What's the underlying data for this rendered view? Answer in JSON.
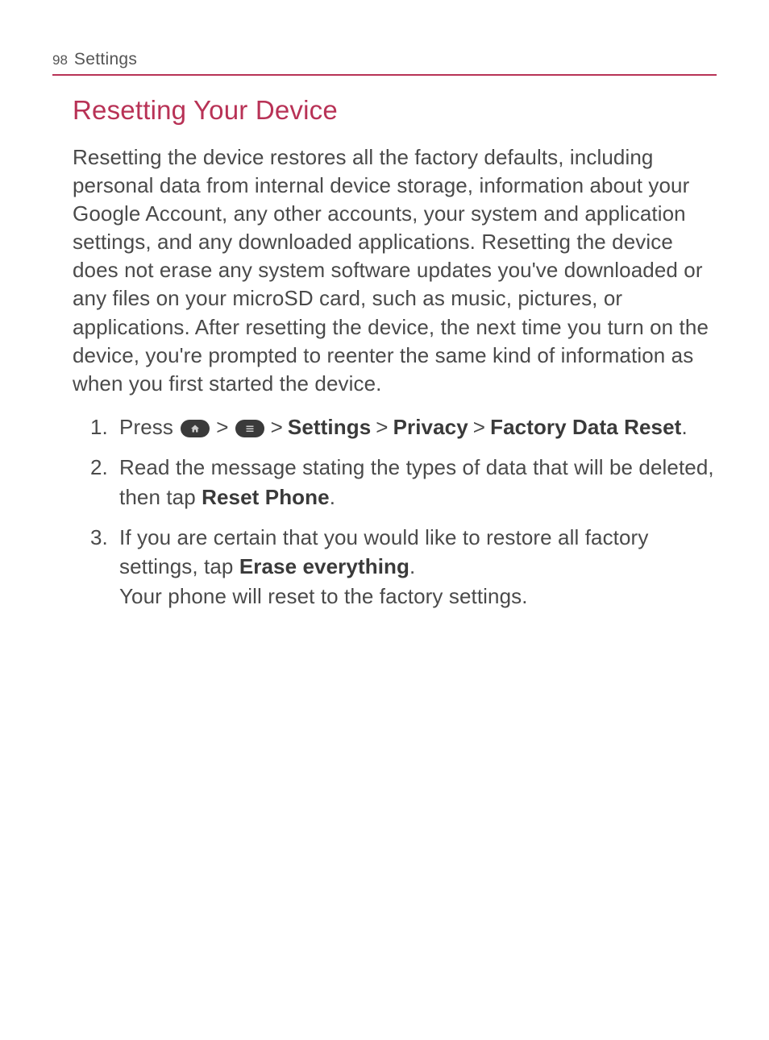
{
  "header": {
    "page_number": "98",
    "section": "Settings"
  },
  "content": {
    "heading": "Resetting Your Device",
    "intro": "Resetting the device restores all the factory defaults, including personal data from internal device storage, information about your Google Account, any other accounts, your system and application settings, and any downloaded applications. Resetting the device does not erase any system software updates you've downloaded or any files on your microSD card, such as music, pictures, or applications. After resetting the device, the next time you turn on the device, you're prompted to reenter the same kind of information as when you first started the device.",
    "steps": [
      {
        "number": "1.",
        "prefix": "Press ",
        "icon1_name": "home-button-icon",
        "sep1": ">",
        "icon2_name": "menu-button-icon",
        "sep2": ">",
        "bold1": "Settings",
        "sep3": ">",
        "bold2": "Privacy",
        "sep4": ">",
        "bold3": "Factory Data Reset",
        "suffix": "."
      },
      {
        "number": "2.",
        "text_before": "Read the message stating the types of data that will be deleted, then tap ",
        "bold": "Reset Phone",
        "text_after": "."
      },
      {
        "number": "3.",
        "text_before": "If you are certain that you would like to restore all factory settings, tap ",
        "bold": "Erase everything",
        "text_after": ".",
        "line2": "Your phone will reset to the factory settings."
      }
    ]
  }
}
